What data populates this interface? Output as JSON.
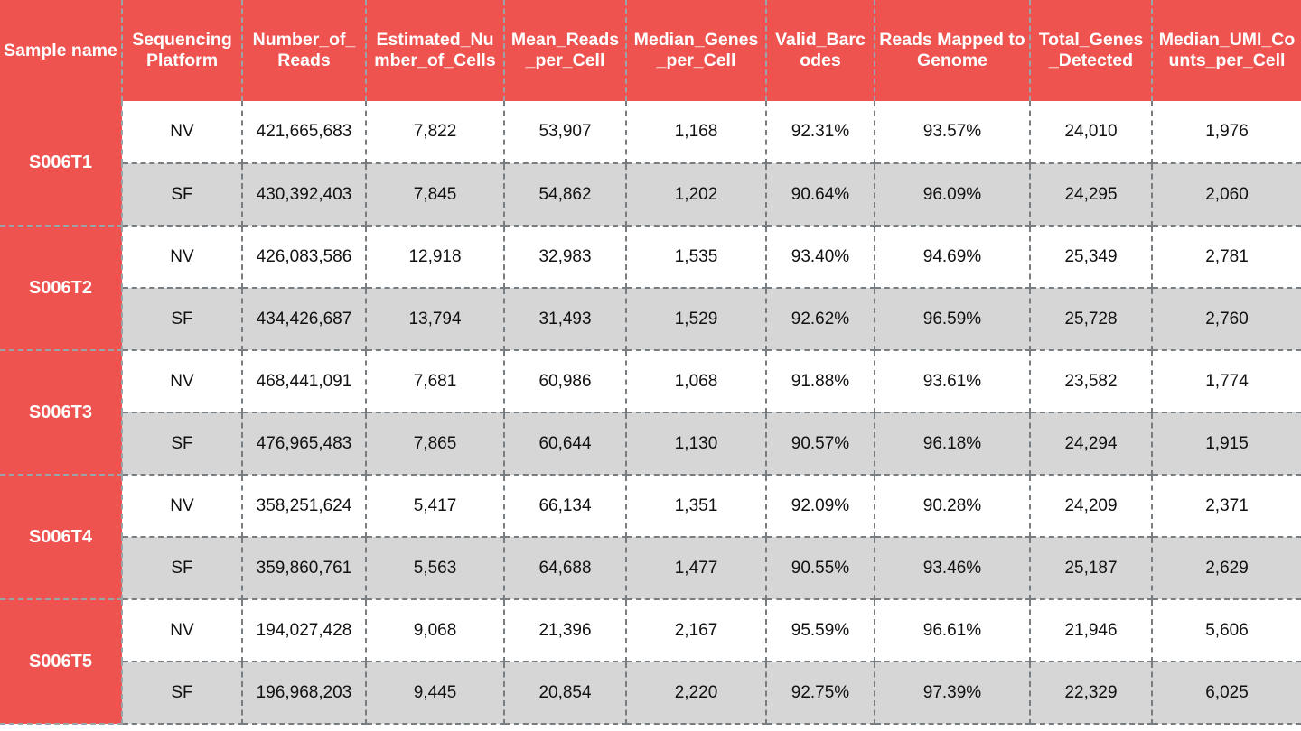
{
  "table": {
    "columns": [
      "Sample name",
      "Sequencing Platform",
      "Number_of_Reads",
      "Estimated_Number_of_Cells",
      "Mean_Reads_per_Cell",
      "Median_Genes_per_Cell",
      "Valid_Barcodes",
      "Reads Mapped to Genome",
      "Total_Genes_Detected",
      "Median_UMI_Counts_per_Cell"
    ],
    "groups": [
      {
        "sample": "S006T1",
        "rows": [
          {
            "platform": "NV",
            "number_of_reads": "421,665,683",
            "estimated_number_of_cells": "7,822",
            "mean_reads_per_cell": "53,907",
            "median_genes_per_cell": "1,168",
            "valid_barcodes": "92.31%",
            "reads_mapped_to_genome": "93.57%",
            "total_genes_detected": "24,010",
            "median_umi_counts_per_cell": "1,976"
          },
          {
            "platform": "SF",
            "number_of_reads": "430,392,403",
            "estimated_number_of_cells": "7,845",
            "mean_reads_per_cell": "54,862",
            "median_genes_per_cell": "1,202",
            "valid_barcodes": "90.64%",
            "reads_mapped_to_genome": "96.09%",
            "total_genes_detected": "24,295",
            "median_umi_counts_per_cell": "2,060"
          }
        ]
      },
      {
        "sample": "S006T2",
        "rows": [
          {
            "platform": "NV",
            "number_of_reads": "426,083,586",
            "estimated_number_of_cells": "12,918",
            "mean_reads_per_cell": "32,983",
            "median_genes_per_cell": "1,535",
            "valid_barcodes": "93.40%",
            "reads_mapped_to_genome": "94.69%",
            "total_genes_detected": "25,349",
            "median_umi_counts_per_cell": "2,781"
          },
          {
            "platform": "SF",
            "number_of_reads": "434,426,687",
            "estimated_number_of_cells": "13,794",
            "mean_reads_per_cell": "31,493",
            "median_genes_per_cell": "1,529",
            "valid_barcodes": "92.62%",
            "reads_mapped_to_genome": "96.59%",
            "total_genes_detected": "25,728",
            "median_umi_counts_per_cell": "2,760"
          }
        ]
      },
      {
        "sample": "S006T3",
        "rows": [
          {
            "platform": "NV",
            "number_of_reads": "468,441,091",
            "estimated_number_of_cells": "7,681",
            "mean_reads_per_cell": "60,986",
            "median_genes_per_cell": "1,068",
            "valid_barcodes": "91.88%",
            "reads_mapped_to_genome": "93.61%",
            "total_genes_detected": "23,582",
            "median_umi_counts_per_cell": "1,774"
          },
          {
            "platform": "SF",
            "number_of_reads": "476,965,483",
            "estimated_number_of_cells": "7,865",
            "mean_reads_per_cell": "60,644",
            "median_genes_per_cell": "1,130",
            "valid_barcodes": "90.57%",
            "reads_mapped_to_genome": "96.18%",
            "total_genes_detected": "24,294",
            "median_umi_counts_per_cell": "1,915"
          }
        ]
      },
      {
        "sample": "S006T4",
        "rows": [
          {
            "platform": "NV",
            "number_of_reads": "358,251,624",
            "estimated_number_of_cells": "5,417",
            "mean_reads_per_cell": "66,134",
            "median_genes_per_cell": "1,351",
            "valid_barcodes": "92.09%",
            "reads_mapped_to_genome": "90.28%",
            "total_genes_detected": "24,209",
            "median_umi_counts_per_cell": "2,371"
          },
          {
            "platform": "SF",
            "number_of_reads": "359,860,761",
            "estimated_number_of_cells": "5,563",
            "mean_reads_per_cell": "64,688",
            "median_genes_per_cell": "1,477",
            "valid_barcodes": "90.55%",
            "reads_mapped_to_genome": "93.46%",
            "total_genes_detected": "25,187",
            "median_umi_counts_per_cell": "2,629"
          }
        ]
      },
      {
        "sample": "S006T5",
        "rows": [
          {
            "platform": "NV",
            "number_of_reads": "194,027,428",
            "estimated_number_of_cells": "9,068",
            "mean_reads_per_cell": "21,396",
            "median_genes_per_cell": "2,167",
            "valid_barcodes": "95.59%",
            "reads_mapped_to_genome": "96.61%",
            "total_genes_detected": "21,946",
            "median_umi_counts_per_cell": "5,606"
          },
          {
            "platform": "SF",
            "number_of_reads": "196,968,203",
            "estimated_number_of_cells": "9,445",
            "mean_reads_per_cell": "20,854",
            "median_genes_per_cell": "2,220",
            "valid_barcodes": "92.75%",
            "reads_mapped_to_genome": "97.39%",
            "total_genes_detected": "22,329",
            "median_umi_counts_per_cell": "6,025"
          }
        ]
      }
    ]
  },
  "colors": {
    "header_background": "#ef5350",
    "header_text": "#ffffff",
    "row_odd_background": "#ffffff",
    "row_even_background": "#d6d6d6",
    "border": "#777d81",
    "body_text": "#111111"
  }
}
